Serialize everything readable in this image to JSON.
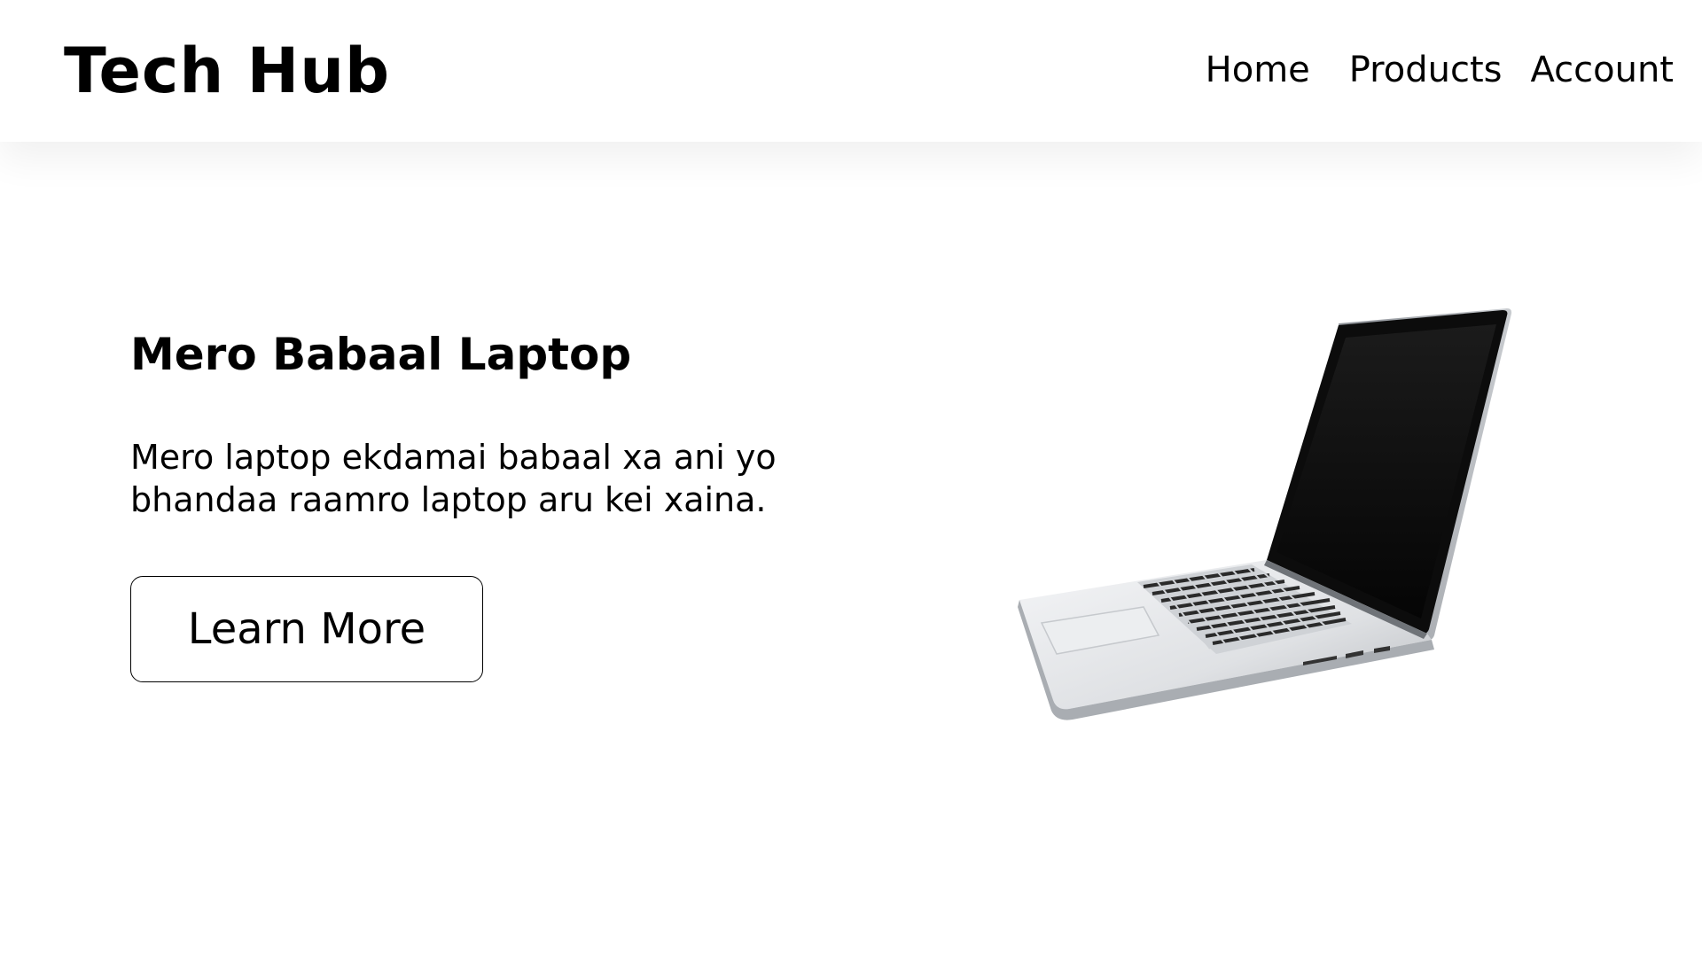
{
  "header": {
    "brand": "Tech Hub",
    "nav": {
      "home": "Home",
      "products": "Products",
      "account": "Account"
    }
  },
  "hero": {
    "title": "Mero Babaal Laptop",
    "description": "Mero laptop ekdamai babaal xa ani yo bhandaa raamro laptop aru kei xaina.",
    "cta_label": "Learn More",
    "image_icon": "laptop-image"
  }
}
